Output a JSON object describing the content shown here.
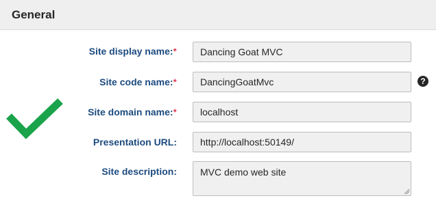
{
  "section": {
    "title": "General"
  },
  "icons": {
    "success": "checkmark-icon",
    "help": "question-icon"
  },
  "colors": {
    "label": "#1c4b7f",
    "required": "#d0021b",
    "check": "#1aa34a"
  },
  "form": {
    "required_marker": "*",
    "fields": [
      {
        "label": "Site display name:",
        "value": "Dancing Goat MVC",
        "required": true
      },
      {
        "label": "Site code name:",
        "value": "DancingGoatMvc",
        "required": true
      },
      {
        "label": "Site domain name:",
        "value": "localhost",
        "required": true
      },
      {
        "label": "Presentation URL:",
        "value": "http://localhost:50149/",
        "required": false
      },
      {
        "label": "Site description:",
        "value": "MVC demo web site",
        "required": false
      }
    ],
    "help_glyph": "?"
  }
}
